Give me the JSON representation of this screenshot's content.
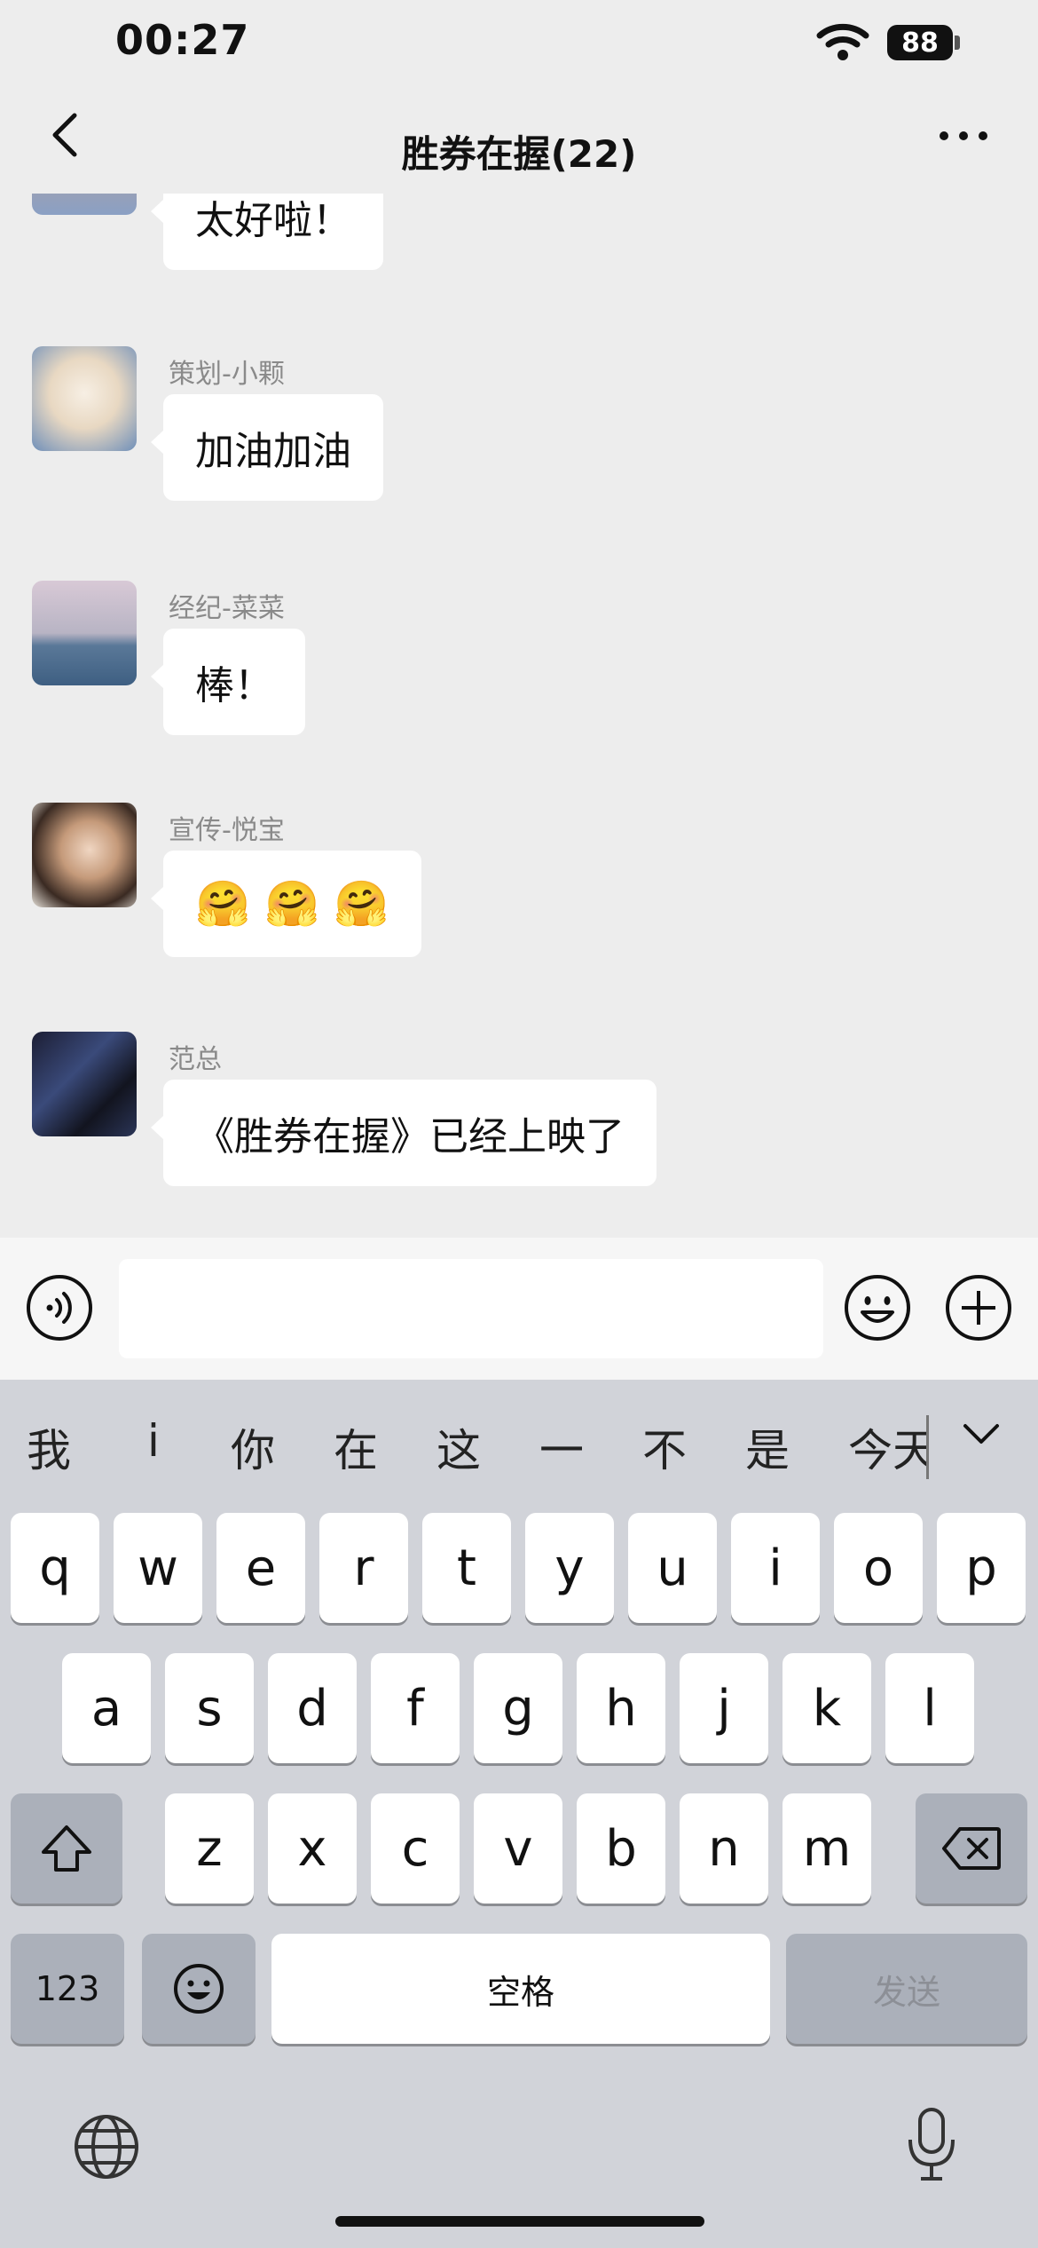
{
  "status_bar": {
    "time": "00:27",
    "battery": "88"
  },
  "nav": {
    "title": "胜券在握(22)"
  },
  "messages": [
    {
      "sender": "",
      "text": "太好啦！"
    },
    {
      "sender": "策划-小颗",
      "text": "加油加油"
    },
    {
      "sender": "经纪-菜菜",
      "text": "棒！"
    },
    {
      "sender": "宣传-悦宝",
      "text": "🤗 🤗 🤗"
    },
    {
      "sender": "范总",
      "text": "《胜券在握》已经上映了"
    }
  ],
  "input": {
    "value": "",
    "placeholder": ""
  },
  "keyboard": {
    "candidates": [
      "我",
      "i",
      "你",
      "在",
      "这",
      "一",
      "不",
      "是",
      "今天"
    ],
    "row1": [
      "q",
      "w",
      "e",
      "r",
      "t",
      "y",
      "u",
      "i",
      "o",
      "p"
    ],
    "row2": [
      "a",
      "s",
      "d",
      "f",
      "g",
      "h",
      "j",
      "k",
      "l"
    ],
    "row3": [
      "z",
      "x",
      "c",
      "v",
      "b",
      "n",
      "m"
    ],
    "num_key": "123",
    "space_key": "空格",
    "send_key": "发送"
  },
  "icons": [
    "back-icon",
    "more-icon",
    "wifi-icon",
    "battery-icon",
    "voice-icon",
    "emoji-icon",
    "plus-icon",
    "shift-icon",
    "delete-icon",
    "emoji-key-icon",
    "globe-icon",
    "mic-icon",
    "chevron-down-icon"
  ],
  "colors": {
    "background": "#ededed",
    "bubble": "#ffffff",
    "keyboard": "#d1d3d9",
    "dark_key": "#abb0ba"
  }
}
